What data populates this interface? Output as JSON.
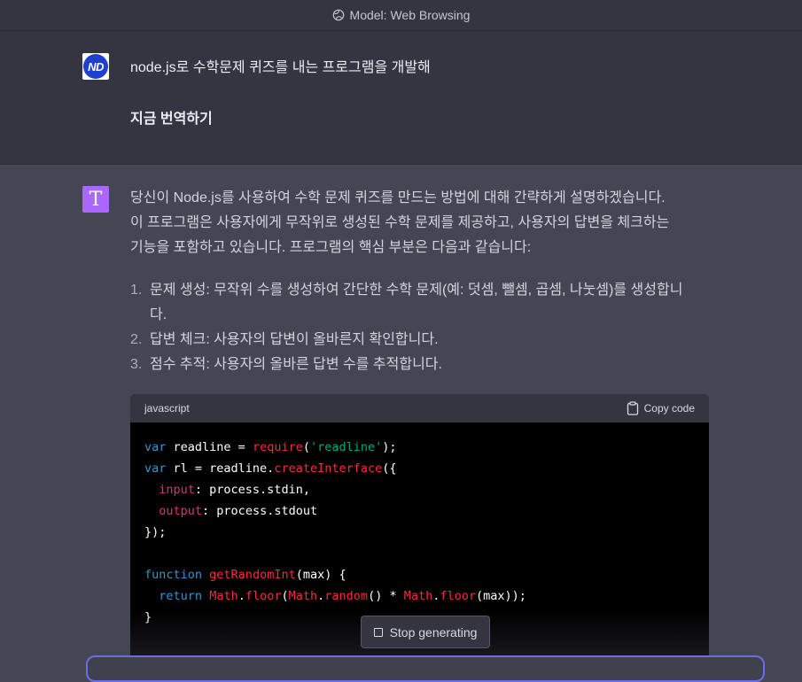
{
  "topbar": {
    "model_label": "Model: Web Browsing",
    "icon": "globe-icon"
  },
  "user_message": {
    "avatar_initials": "ND",
    "line1": "node.js로 수학문제 퀴즈를 내는 프로그램을 개발해",
    "line2": "지금 번역하기"
  },
  "assistant_message": {
    "avatar_glyph": "T",
    "paragraph": [
      "당신이 Node.js를 사용하여 수학 문제 퀴즈를 만드는 방법에 대해 간략하게 설명하겠습니다.",
      "이 프로그램은 사용자에게 무작위로 생성된 수학 문제를 제공하고, 사용자의 답변을 체크하는",
      "기능을 포함하고 있습니다. 프로그램의 핵심 부분은 다음과 같습니다:"
    ],
    "list": [
      {
        "num": "1.",
        "line1": "문제 생성: 무작위 수를 생성하여 간단한 수학 문제(예: 덧셈, 뺄셈, 곱셈, 나눗셈)를 생성합니",
        "line2": "다."
      },
      {
        "num": "2.",
        "line1": "답변 체크: 사용자의 답변이 올바른지 확인합니다.",
        "line2": ""
      },
      {
        "num": "3.",
        "line1": "점수 추적: 사용자의 올바른 답변 수를 추적합니다.",
        "line2": ""
      }
    ]
  },
  "code_block": {
    "language": "javascript",
    "copy_label": "Copy code",
    "lines": [
      [
        [
          "kw",
          "var"
        ],
        [
          "pl",
          " readline = "
        ],
        [
          "fn",
          "require"
        ],
        [
          "pl",
          "("
        ],
        [
          "str",
          "'readline'"
        ],
        [
          "pl",
          ");"
        ]
      ],
      [
        [
          "kw",
          "var"
        ],
        [
          "pl",
          " rl = readline."
        ],
        [
          "fn",
          "createInterface"
        ],
        [
          "pl",
          "({"
        ]
      ],
      [
        [
          "pl",
          "  "
        ],
        [
          "prop",
          "input"
        ],
        [
          "pl",
          ": process.stdin,"
        ]
      ],
      [
        [
          "pl",
          "  "
        ],
        [
          "prop",
          "output"
        ],
        [
          "pl",
          ": process.stdout"
        ]
      ],
      [
        [
          "pl",
          "});"
        ]
      ],
      [
        [
          "pl",
          ""
        ]
      ],
      [
        [
          "kw",
          "function"
        ],
        [
          "pl",
          " "
        ],
        [
          "fn",
          "getRandomInt"
        ],
        [
          "pl",
          "(max) {"
        ]
      ],
      [
        [
          "pl",
          "  "
        ],
        [
          "kw",
          "return"
        ],
        [
          "pl",
          " "
        ],
        [
          "fn",
          "Math"
        ],
        [
          "pl",
          "."
        ],
        [
          "fn",
          "floor"
        ],
        [
          "pl",
          "("
        ],
        [
          "fn",
          "Math"
        ],
        [
          "pl",
          "."
        ],
        [
          "fn",
          "random"
        ],
        [
          "pl",
          "() * "
        ],
        [
          "fn",
          "Math"
        ],
        [
          "pl",
          "."
        ],
        [
          "fn",
          "floor"
        ],
        [
          "pl",
          "(max));"
        ]
      ],
      [
        [
          "pl",
          "}"
        ]
      ]
    ]
  },
  "stop_button": {
    "label": "Stop generating"
  },
  "colors": {
    "accent": "#ab68ff",
    "keyword": "#2e95d3",
    "function": "#f22c3d",
    "string": "#00a67d",
    "property": "#df3079"
  }
}
